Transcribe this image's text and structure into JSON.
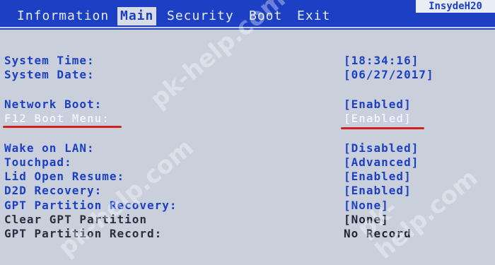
{
  "menu": {
    "tabs": [
      {
        "label": "Information"
      },
      {
        "label": "Main"
      },
      {
        "label": "Security"
      },
      {
        "label": "Boot"
      },
      {
        "label": "Exit"
      }
    ],
    "brand": "InsydeH20"
  },
  "settings": {
    "system_time": {
      "label": "System Time:",
      "value": "[18:34:16]"
    },
    "system_date": {
      "label": "System Date:",
      "value": "[06/27/2017]"
    },
    "network_boot": {
      "label": "Network Boot:",
      "value": "[Enabled]"
    },
    "f12_boot_menu": {
      "label": "F12 Boot Menu:",
      "value": "[Enabled]"
    },
    "wake_on_lan": {
      "label": "Wake on LAN:",
      "value": "[Disabled]"
    },
    "touchpad": {
      "label": "Touchpad:",
      "value": "[Advanced]"
    },
    "lid_open_resume": {
      "label": "Lid Open Resume:",
      "value": "[Enabled]"
    },
    "d2d_recovery": {
      "label": "D2D Recovery:",
      "value": "[Enabled]"
    },
    "gpt_partition_recovery": {
      "label": "GPT Partition Recovery:",
      "value": "[None]"
    },
    "clear_gpt_partition": {
      "label": "Clear GPT Partition",
      "value": "[None]"
    },
    "gpt_partition_record": {
      "label": "GPT Partition Record:",
      "value": "No Record"
    }
  },
  "watermark": "pk-help.com",
  "colors": {
    "accent": "#1c3fc3",
    "background": "#c9d0dc",
    "highlight_mark": "#d21f1f"
  }
}
